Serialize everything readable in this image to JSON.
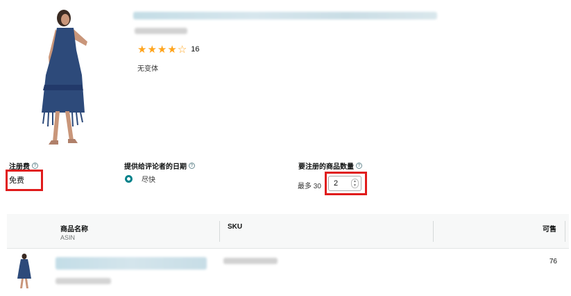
{
  "product": {
    "rating_count": "16",
    "stars_filled": 4,
    "stars_total": 5,
    "variant_text": "无变体"
  },
  "settings": {
    "fee": {
      "label": "注册费",
      "value": "免费"
    },
    "review_date": {
      "label": "提供给评论者的日期",
      "option": "尽快"
    },
    "quantity": {
      "label": "要注册的商品数量",
      "max_text": "最多 30",
      "value": "2"
    }
  },
  "table": {
    "headers": {
      "name": "商品名称",
      "asin": "ASIN",
      "sku": "SKU",
      "available": "可售"
    },
    "rows": [
      {
        "available": "76"
      }
    ]
  },
  "colors": {
    "highlight": "#e01b1b",
    "radio_accent": "#00818a",
    "star": "#ffa41c"
  },
  "icons": {
    "help": "question-circle-icon",
    "rating": "star-icon",
    "stepper": "up-down-stepper-icon"
  }
}
